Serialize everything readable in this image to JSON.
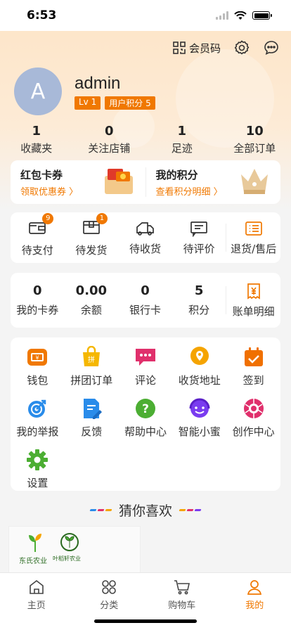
{
  "status": {
    "time": "6:53"
  },
  "header": {
    "member_code": "会员码"
  },
  "profile": {
    "avatar_letter": "A",
    "username": "admin",
    "level": "Lv 1",
    "points_badge": "用户积分 5"
  },
  "stats": [
    {
      "num": "1",
      "label": "收藏夹"
    },
    {
      "num": "0",
      "label": "关注店铺"
    },
    {
      "num": "1",
      "label": "足迹"
    },
    {
      "num": "10",
      "label": "全部订单"
    }
  ],
  "promo": {
    "coupon_title": "红包卡券",
    "coupon_sub": "领取优惠券 〉",
    "points_title": "我的积分",
    "points_sub": "查看积分明细 〉"
  },
  "orders": [
    {
      "label": "待支付",
      "icon": "wallet-icon",
      "badge": "9"
    },
    {
      "label": "待发货",
      "icon": "box-icon",
      "badge": "1"
    },
    {
      "label": "待收货",
      "icon": "truck-icon",
      "badge": ""
    },
    {
      "label": "待评价",
      "icon": "comment-icon",
      "badge": ""
    },
    {
      "label": "退货/售后",
      "icon": "return-icon",
      "badge": ""
    }
  ],
  "wallet": [
    {
      "val": "0",
      "label": "我的卡券"
    },
    {
      "val": "0.00",
      "label": "余额"
    },
    {
      "val": "0",
      "label": "银行卡"
    },
    {
      "val": "5",
      "label": "积分"
    },
    {
      "val": "",
      "label": "账单明细"
    }
  ],
  "services": [
    {
      "label": "钱包",
      "icon": "wallet-icon",
      "color": "#f07800"
    },
    {
      "label": "拼团订单",
      "icon": "group-buy-icon",
      "color": "#f5b700"
    },
    {
      "label": "评论",
      "icon": "comment-icon",
      "color": "#e0306c"
    },
    {
      "label": "收货地址",
      "icon": "location-icon",
      "color": "#f5a400"
    },
    {
      "label": "签到",
      "icon": "calendar-icon",
      "color": "#f07000"
    },
    {
      "label": "我的举报",
      "icon": "target-icon",
      "color": "#2a8cea"
    },
    {
      "label": "反馈",
      "icon": "edit-icon",
      "color": "#2a8cea"
    },
    {
      "label": "帮助中心",
      "icon": "help-icon",
      "color": "#4cae33"
    },
    {
      "label": "智能小蜜",
      "icon": "assistant-icon",
      "color": "#7a3cf0"
    },
    {
      "label": "创作中心",
      "icon": "camera-icon",
      "color": "#e0306c"
    },
    {
      "label": "设置",
      "icon": "gear-icon",
      "color": "#4cae33"
    }
  ],
  "guess_title": "猜你喜欢",
  "product": {
    "brand_1": "东氏农业",
    "brand_2": "叶稻轩农业"
  },
  "tabs": [
    {
      "label": "主页",
      "icon": "home-icon"
    },
    {
      "label": "分类",
      "icon": "category-icon"
    },
    {
      "label": "购物车",
      "icon": "cart-icon"
    },
    {
      "label": "我的",
      "icon": "user-icon"
    }
  ],
  "colors": {
    "accent": "#f07800",
    "header_bg": "#fde4c6",
    "avatar_bg": "#a8b9d8"
  }
}
